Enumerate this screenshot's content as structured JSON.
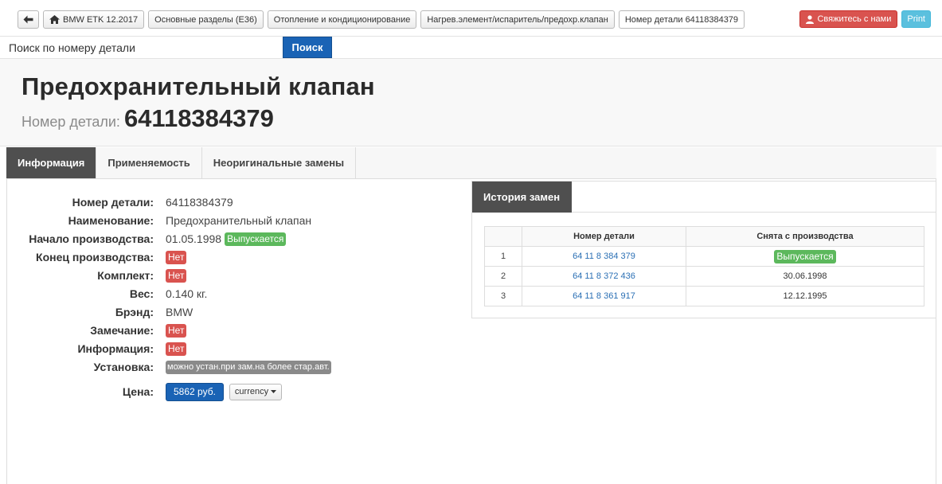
{
  "breadcrumbs": {
    "items": [
      "BMW ETK 12.2017",
      "Основные разделы (E36)",
      "Отопление и кондиционирование",
      "Нагрев.элемент/испаритель/предохр.клапан",
      "Номер детали 64118384379"
    ]
  },
  "actions": {
    "contact_label": "Свяжитесь с нами",
    "print_label": "Print"
  },
  "search": {
    "label": "Поиск по номеру детали",
    "value": "",
    "button_label": "Поиск"
  },
  "header": {
    "title": "Предохранительный клапан",
    "part_label": "Номер детали:",
    "part_number": "64118384379"
  },
  "tabs": [
    "Информация",
    "Применяемость",
    "Неоригинальные замены"
  ],
  "details": {
    "part_number_label": "Номер детали:",
    "part_number": "64118384379",
    "name_label": "Наименование:",
    "name": "Предохранительный клапан",
    "start_label": "Начало производства:",
    "start": "01.05.1998",
    "start_badge": "Выпускается",
    "end_label": "Конец производства:",
    "end_badge": "Нет",
    "kit_label": "Комплект:",
    "kit_badge": "Нет",
    "weight_label": "Вес:",
    "weight": "0.140 кг.",
    "brand_label": "Брэнд:",
    "brand": "BMW",
    "remark_label": "Замечание:",
    "remark_badge": "Нет",
    "info_label": "Информация:",
    "info_badge": "Нет",
    "install_label": "Установка:",
    "install_badge": "можно устан.при зам.на более стар.авт.",
    "price_label": "Цена:",
    "price": "5862 руб.",
    "currency_label": "currency"
  },
  "history": {
    "tab_label": "История замен",
    "columns": [
      "",
      "Номер детали",
      "Снята с производства"
    ],
    "rows": [
      {
        "index": "1",
        "part": "64 11 8 384 379",
        "status": "Выпускается",
        "status_is_badge": true
      },
      {
        "index": "2",
        "part": "64 11 8 372 436",
        "status": "30.06.1998",
        "status_is_badge": false
      },
      {
        "index": "3",
        "part": "64 11 8 361 917",
        "status": "12.12.1995",
        "status_is_badge": false
      }
    ]
  },
  "colors": {
    "primary": "#1a63b5",
    "danger": "#d9534f",
    "success": "#5cb85c",
    "info": "#5bc0de",
    "tab_active": "#4f4f4f"
  }
}
